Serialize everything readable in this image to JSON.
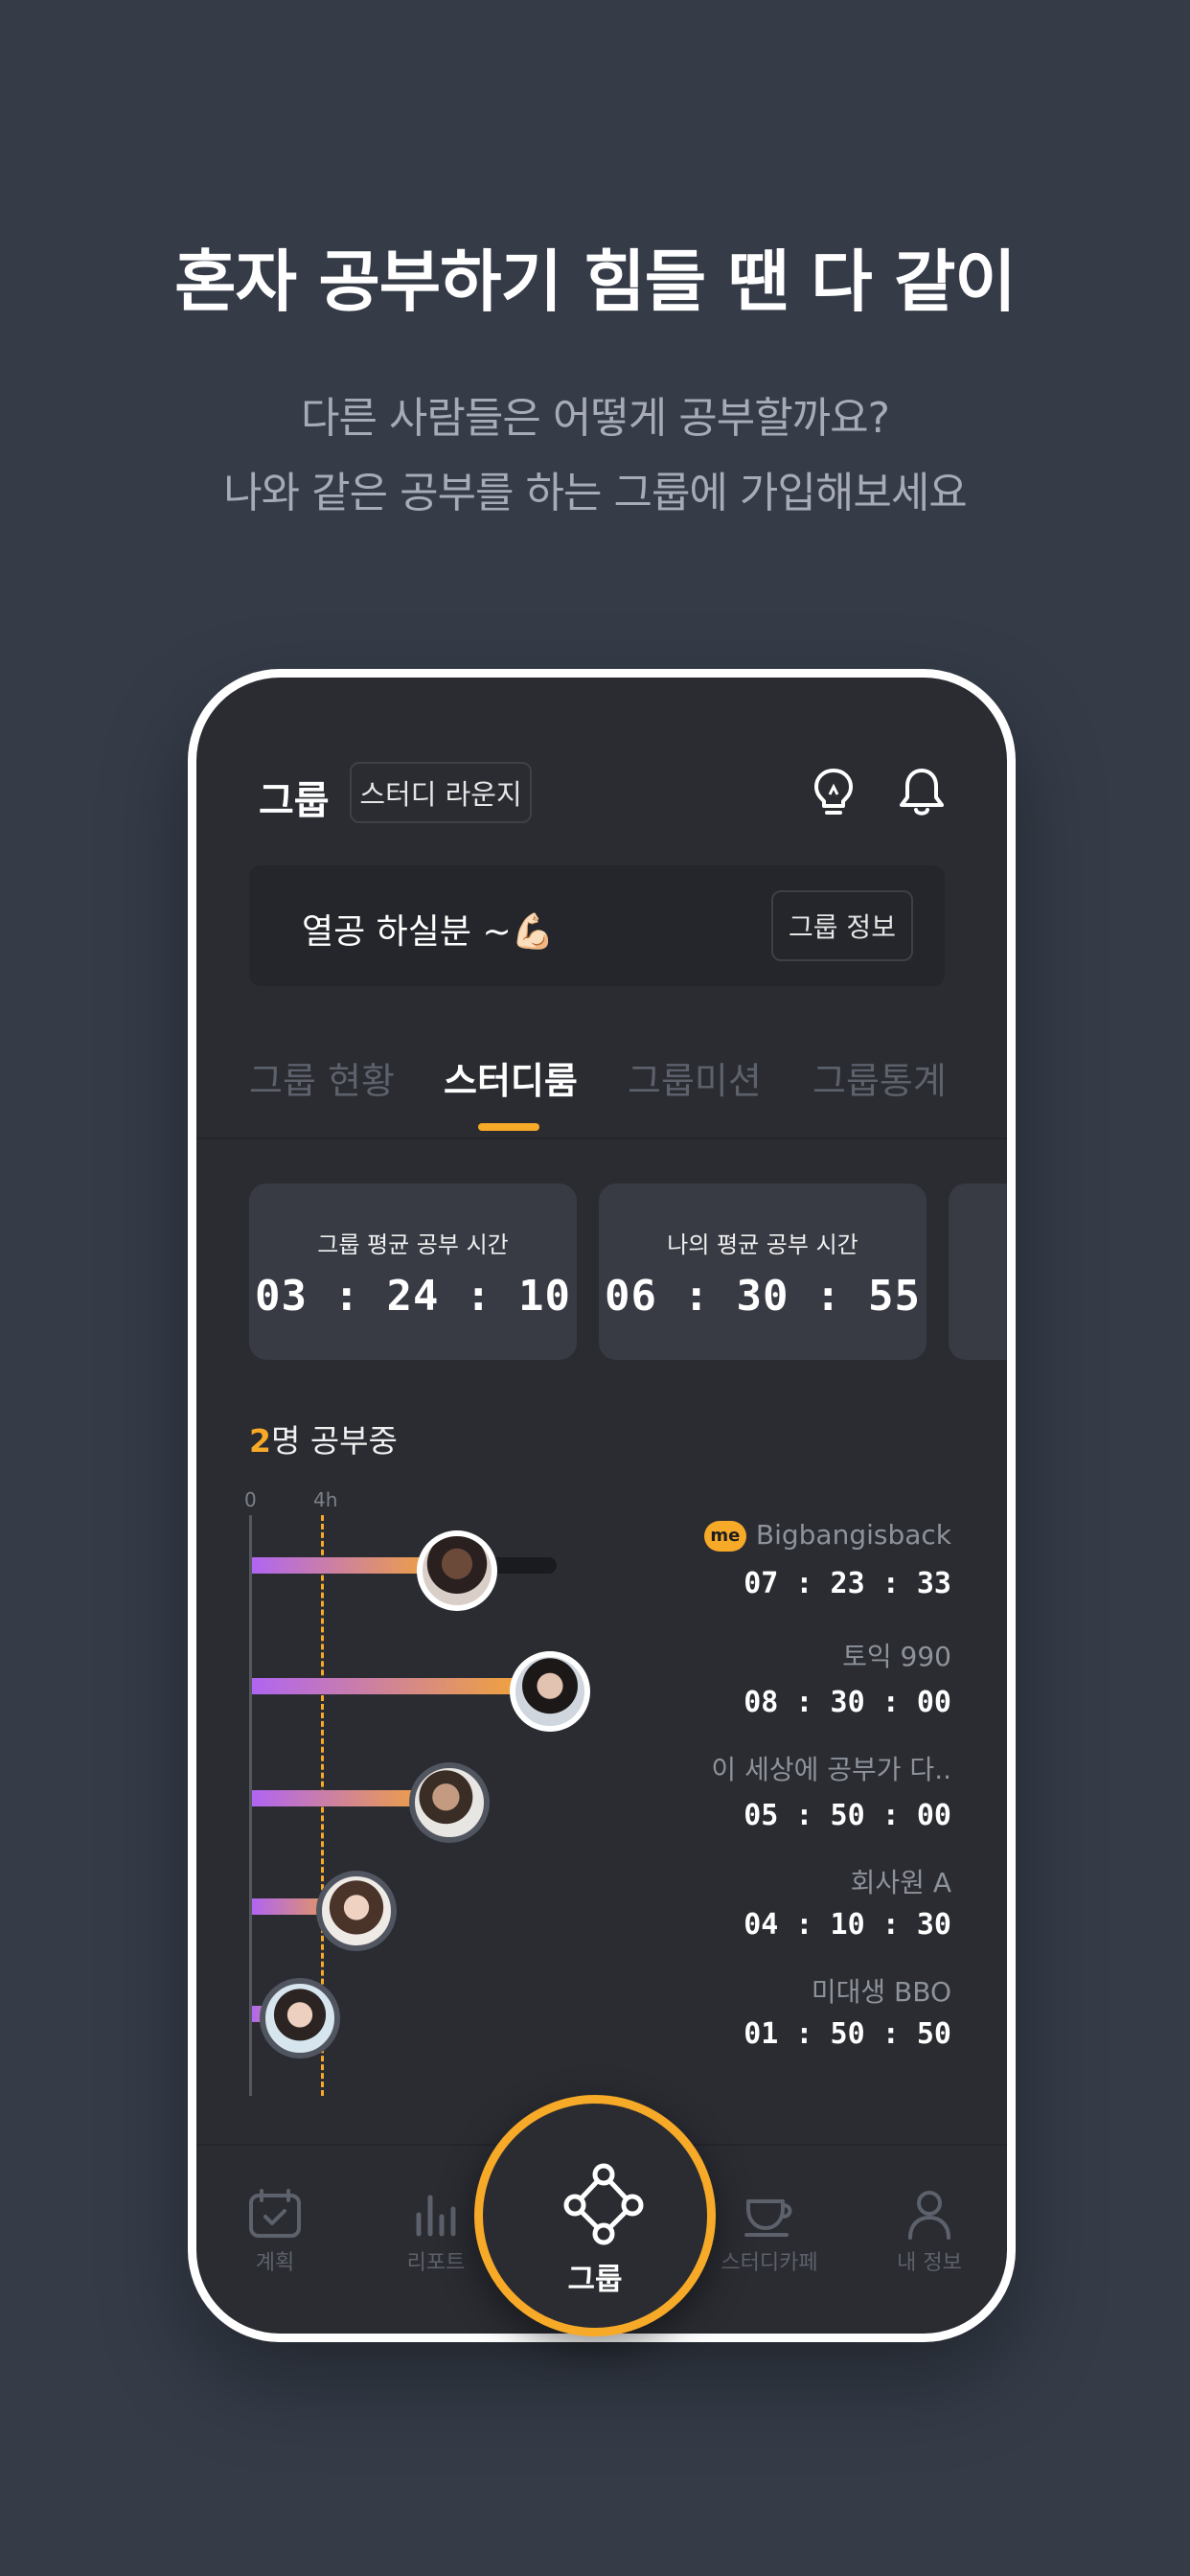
{
  "headline": "혼자 공부하기 힘들 땐 다 같이",
  "subline1": "다른 사람들은 어떻게 공부할까요?",
  "subline2": "나와 같은 공부를 하는 그룹에 가입해보세요",
  "header": {
    "title": "그룹",
    "lounge_button": "스터디 라운지",
    "icons": [
      "lightbulb-icon",
      "bell-icon"
    ]
  },
  "greeting": {
    "text": "열공 하실분 ~💪🏻",
    "info_button": "그룹 정보"
  },
  "tabs": [
    {
      "label": "그룹 현황",
      "active": false
    },
    {
      "label": "스터디룸",
      "active": true
    },
    {
      "label": "그룹미션",
      "active": false
    },
    {
      "label": "그룹통계",
      "active": false
    }
  ],
  "stats": [
    {
      "label": "그룹 평균 공부 시간",
      "time": "03 : 24 : 10"
    },
    {
      "label": "나의 평균 공부 시간",
      "time": "06 : 30 : 55"
    }
  ],
  "studying": {
    "count": "2",
    "suffix": "명 공부중"
  },
  "axis": {
    "start": "0",
    "mark": "4h"
  },
  "members": [
    {
      "name": "Bigbangisback",
      "time": "07 : 23 : 33",
      "me": true,
      "me_badge": "me",
      "progress": 0.51
    },
    {
      "name": "토익 990",
      "time": "08 : 30 : 00",
      "me": false,
      "progress": 0.74
    },
    {
      "name": "이 세상에 공부가 다..",
      "time": "05 : 50 : 00",
      "me": false,
      "progress": 0.49
    },
    {
      "name": "회사원 A",
      "time": "04 : 10 : 30",
      "me": false,
      "progress": 0.26
    },
    {
      "name": "미대생 BBO",
      "time": "01 : 50 : 50",
      "me": false,
      "progress": 0.12
    }
  ],
  "bottom_nav": [
    {
      "label": "계획",
      "icon": "calendar-check-icon"
    },
    {
      "label": "리포트",
      "icon": "bar-chart-icon"
    },
    {
      "label": "그룹",
      "icon": "group-network-icon",
      "active": true
    },
    {
      "label": "스터디카페",
      "icon": "coffee-cup-icon"
    },
    {
      "label": "내 정보",
      "icon": "person-icon"
    }
  ],
  "colors": {
    "background": "#353c48",
    "phone_bg": "#2a2c32",
    "accent": "#f7a928",
    "bar_start": "#b065f2"
  }
}
